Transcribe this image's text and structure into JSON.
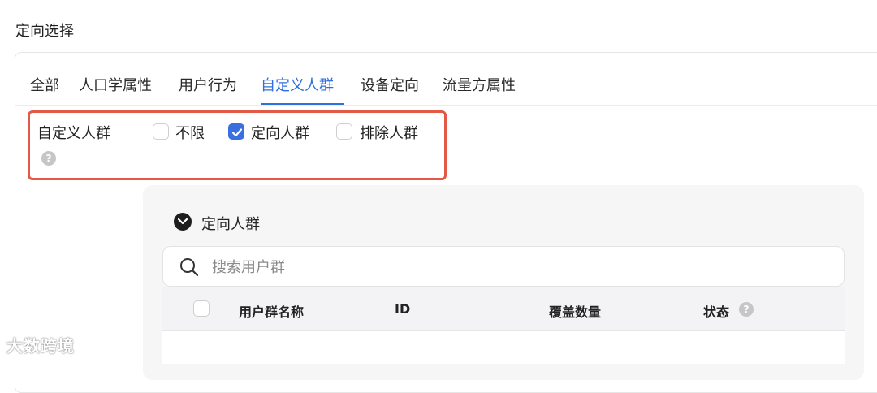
{
  "section": {
    "title": "定向选择"
  },
  "tabs": [
    {
      "label": "全部",
      "active": false
    },
    {
      "label": "人口学属性",
      "active": false
    },
    {
      "label": "用户行为",
      "active": false
    },
    {
      "label": "自定义人群",
      "active": true
    },
    {
      "label": "设备定向",
      "active": false
    },
    {
      "label": "流量方属性",
      "active": false
    }
  ],
  "custom_audience": {
    "label": "自定义人群",
    "help_icon": "question-circle-icon",
    "options": [
      {
        "label": "不限",
        "checked": false
      },
      {
        "label": "定向人群",
        "checked": true
      },
      {
        "label": "排除人群",
        "checked": false
      }
    ]
  },
  "targeted_group": {
    "title": "定向人群",
    "expand_icon": "chevron-down-circle-icon",
    "search": {
      "placeholder": "搜索用户群",
      "value": "",
      "icon": "search-icon"
    },
    "table": {
      "columns": [
        "用户群名称",
        "ID",
        "覆盖数量",
        "状态"
      ],
      "rows": []
    }
  },
  "watermark": "大数跨境",
  "colors": {
    "accent": "#2f6fe0",
    "highlight": "#e25a45",
    "panel_bg": "#f6f6f7"
  }
}
